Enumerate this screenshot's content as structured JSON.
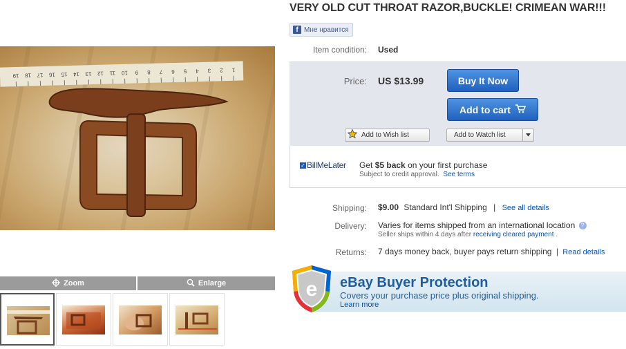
{
  "listing": {
    "title": "VERY OLD CUT THROAT RAZOR,BUCKLE! CRIMEAN WAR!!!",
    "like_label": "Мне нравится",
    "condition_label": "Item condition:",
    "condition_value": "Used",
    "price_label": "Price:",
    "price_value": "US $13.99",
    "buy_now_label": "Buy It Now",
    "add_to_cart_label": "Add to cart",
    "wish_list_label": "Add to Wish list",
    "watch_list_label": "Add to Watch list"
  },
  "bill_me_later": {
    "logo_text": "BillMeLater",
    "offer_prefix": "Get ",
    "offer_amount": "$5 back",
    "offer_suffix": " on your first purchase",
    "subject_text": "Subject to credit approval.",
    "see_terms": "See terms"
  },
  "shipping": {
    "label": "Shipping:",
    "price": "$9.00",
    "method": "Standard Int'l Shipping",
    "separator": "|",
    "details_link": "See all details"
  },
  "delivery": {
    "label": "Delivery:",
    "text": "Varies for items shipped from an international location",
    "sub_prefix": "Seller ships within 4 days after",
    "sub_link": "receiving cleared payment",
    "sub_suffix": "."
  },
  "returns": {
    "label": "Returns:",
    "text": "7 days money back, buyer pays return shipping",
    "separator": "|",
    "details_link": "Read details"
  },
  "buyer_protection": {
    "title": "eBay Buyer Protection",
    "subtitle": "Covers your purchase price plus original shipping.",
    "learn_more": "Learn more"
  },
  "viewer": {
    "zoom_label": "Zoom",
    "enlarge_label": "Enlarge",
    "ruler_numbers": [
      "1",
      "2",
      "3",
      "4",
      "5",
      "6",
      "7",
      "8",
      "9",
      "10",
      "11",
      "12",
      "13",
      "14",
      "15",
      "16",
      "17",
      "18",
      "19"
    ]
  },
  "colors": {
    "link": "#0654ba",
    "button_blue": "#1f61bd",
    "price_box": "#e3e6ec",
    "rust": "#8a4a22"
  },
  "icons": {
    "zoom": "crosshair-icon",
    "enlarge": "magnifier-icon",
    "cart": "cart-icon",
    "wish": "star-icon",
    "info": "question-icon",
    "shield": "ebay-shield-icon"
  }
}
